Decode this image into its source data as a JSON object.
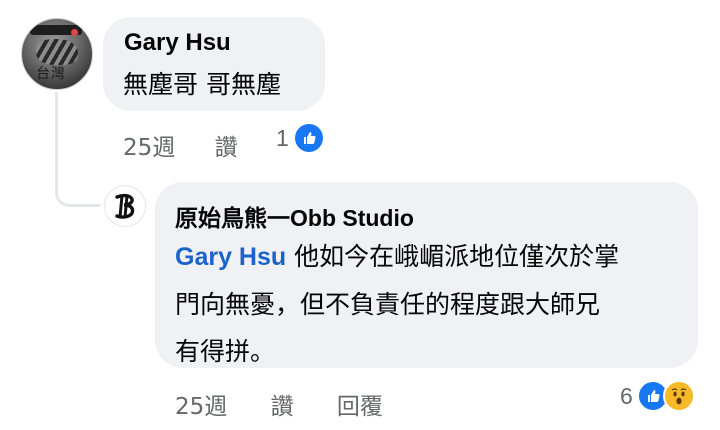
{
  "comment1": {
    "author": "Gary Hsu",
    "text": "無塵哥  哥無塵",
    "time": "25週",
    "like_label": "讚",
    "reaction_count": "1"
  },
  "comment2": {
    "author": "原始鳥熊一Obb Studio",
    "mention": "Gary Hsu",
    "line1_rest": " 他如今在峨嵋派地位僅次於掌",
    "line2": "門向無憂，但不負責任的程度跟大師兄",
    "line3": "有得拼。",
    "time": "25週",
    "like_label": "讚",
    "reply_label": "回覆",
    "reaction_count": "6"
  },
  "avatar1_caption": "台灣",
  "colors": {
    "bubble": "#eff1f4",
    "mention": "#1a64c8",
    "meta_text": "#65676b",
    "like_blue": "#1877f2",
    "wow_yellow": "#f7b928"
  }
}
